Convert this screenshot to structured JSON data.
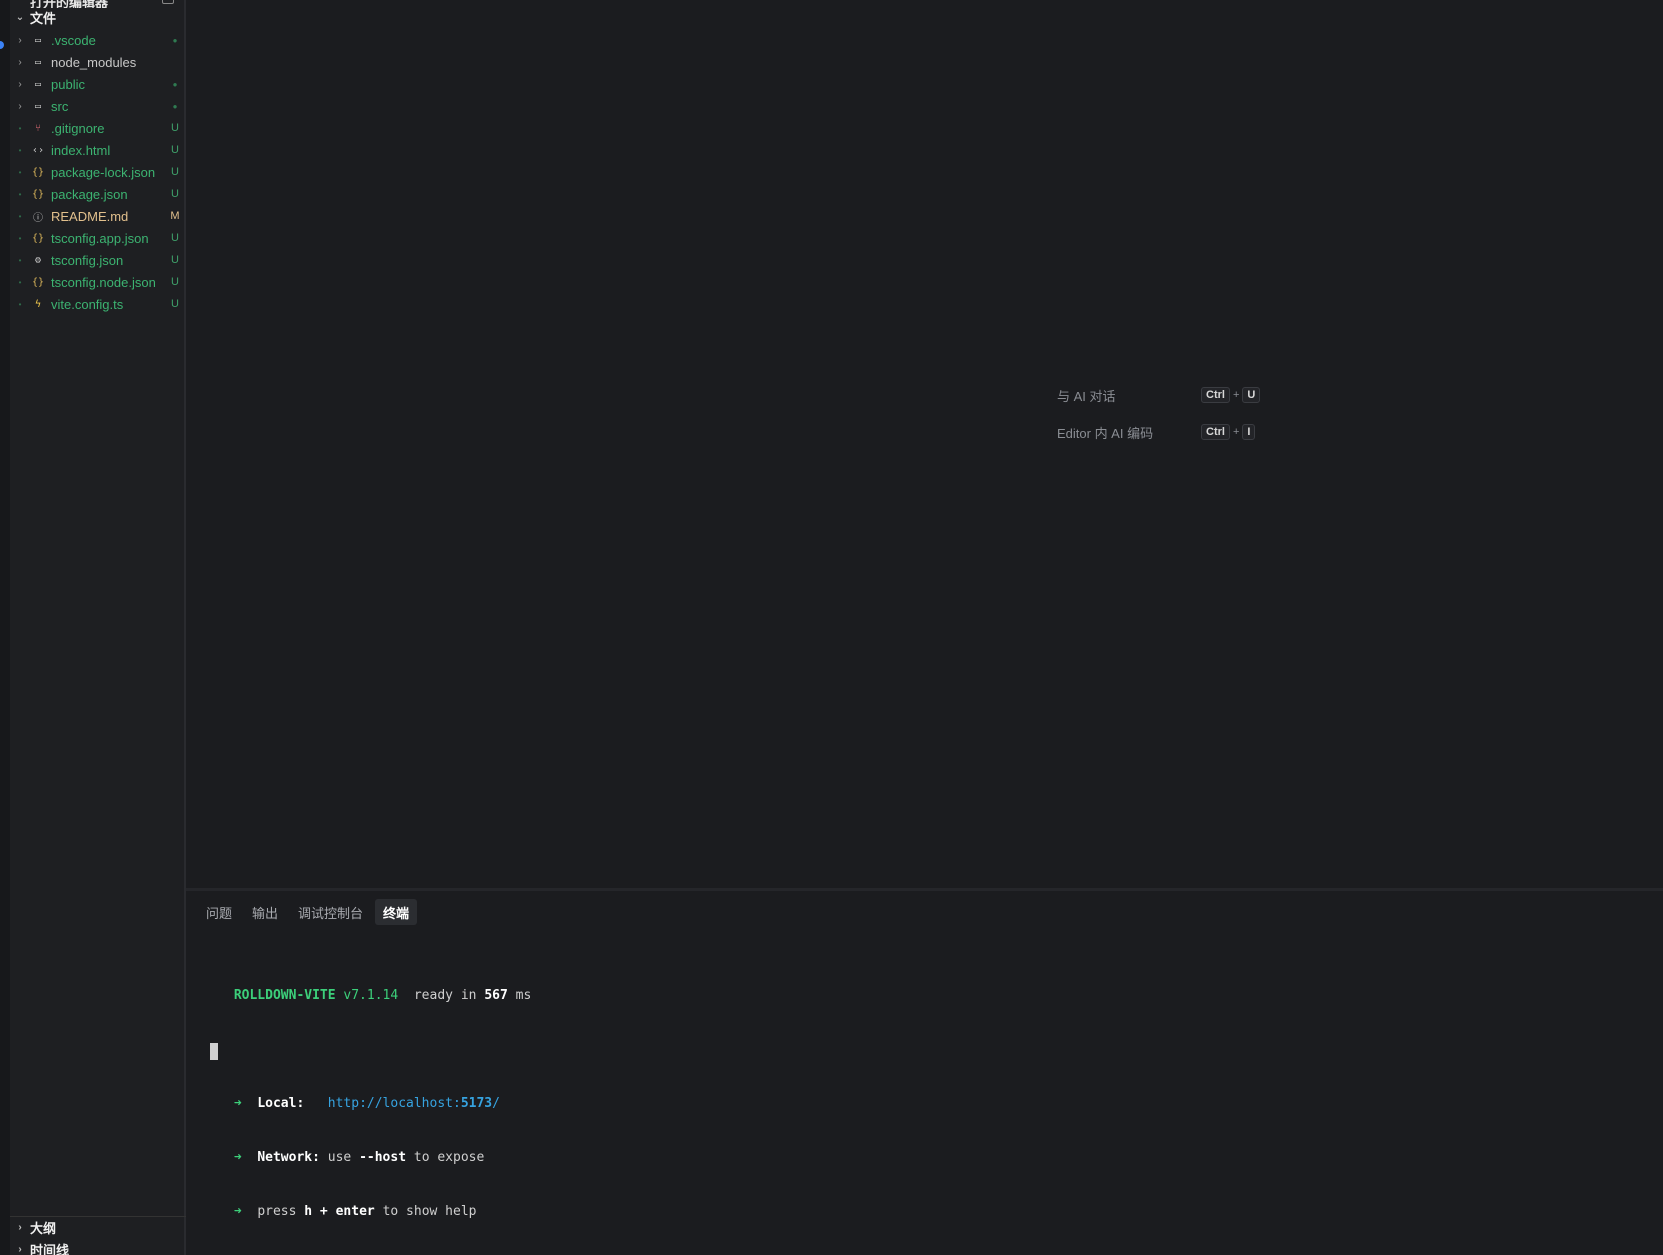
{
  "sidebar": {
    "open_editors_label": "打开的编辑器",
    "files_section": {
      "label": "文件",
      "expanded": true
    },
    "items": [
      {
        "name": ".vscode",
        "kind": "folder",
        "color": "green",
        "badge": "●",
        "icon": "folder-icon"
      },
      {
        "name": "node_modules",
        "kind": "folder",
        "color": "gray",
        "badge": "",
        "icon": "folder-icon"
      },
      {
        "name": "public",
        "kind": "folder",
        "color": "green",
        "badge": "●",
        "icon": "folder-icon"
      },
      {
        "name": "src",
        "kind": "folder",
        "color": "green",
        "badge": "●",
        "icon": "folder-icon"
      },
      {
        "name": ".gitignore",
        "kind": "file",
        "color": "green",
        "badge": "U",
        "icon": "git-branch-icon"
      },
      {
        "name": "index.html",
        "kind": "file",
        "color": "green",
        "badge": "U",
        "icon": "code-brackets-icon"
      },
      {
        "name": "package-lock.json",
        "kind": "file",
        "color": "green",
        "badge": "U",
        "icon": "json-braces-icon"
      },
      {
        "name": "package.json",
        "kind": "file",
        "color": "green",
        "badge": "U",
        "icon": "json-braces-icon"
      },
      {
        "name": "README.md",
        "kind": "file",
        "color": "yellow",
        "badge": "M",
        "icon": "info-icon"
      },
      {
        "name": "tsconfig.app.json",
        "kind": "file",
        "color": "green",
        "badge": "U",
        "icon": "json-braces-icon"
      },
      {
        "name": "tsconfig.json",
        "kind": "file",
        "color": "green",
        "badge": "U",
        "icon": "gear-icon"
      },
      {
        "name": "tsconfig.node.json",
        "kind": "file",
        "color": "green",
        "badge": "U",
        "icon": "json-braces-icon"
      },
      {
        "name": "vite.config.ts",
        "kind": "file",
        "color": "green",
        "badge": "U",
        "icon": "lightning-icon"
      }
    ],
    "outline_label": "大纲",
    "timeline_label": "时间线"
  },
  "editor": {
    "hints": [
      {
        "label": "与 AI 对话",
        "key1": "Ctrl",
        "plus": "+",
        "key2": "U"
      },
      {
        "label": "Editor 内 AI 编码",
        "key1": "Ctrl",
        "plus": "+",
        "key2": "I"
      }
    ]
  },
  "panel": {
    "tabs": [
      {
        "label": "问题",
        "active": false
      },
      {
        "label": "输出",
        "active": false
      },
      {
        "label": "调试控制台",
        "active": false
      },
      {
        "label": "终端",
        "active": true
      }
    ],
    "terminal": {
      "app_name": "ROLLDOWN-VITE",
      "version": "v7.1.14",
      "ready_prefix": "ready in",
      "ready_ms": "567",
      "ready_unit": "ms",
      "arrow": "➜",
      "local_label": "Local:",
      "local_url_prefix": "http://localhost:",
      "local_url_port": "5173",
      "local_url_suffix": "/",
      "network_label": "Network:",
      "network_use": "use",
      "network_flag": "--host",
      "network_rest": "to expose",
      "press": "press",
      "help_keys": "h + enter",
      "help_rest": "to show help"
    }
  },
  "colors": {
    "background": "#1b1c1f",
    "sidebar_bg": "#1e1f22",
    "git_untracked": "#3cb371",
    "git_modified": "#e2c08d",
    "terminal_green": "#3ccf7a",
    "terminal_link": "#36a3e0"
  }
}
